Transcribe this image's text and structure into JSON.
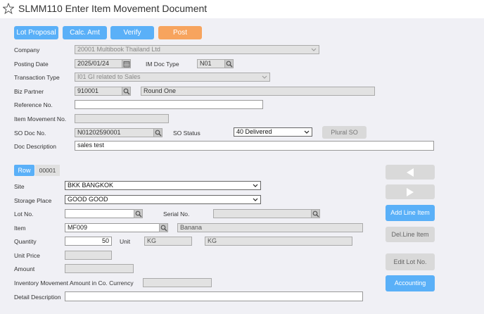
{
  "title": "SLMM110 Enter Item Movement Document",
  "toolbar": {
    "lot_proposal": "Lot Proposal",
    "calc_amt": "Calc. Amt",
    "verify": "Verify",
    "post": "Post"
  },
  "header": {
    "company_label": "Company",
    "company_value": "20001 Multibook Thailand Ltd",
    "posting_date_label": "Posting Date",
    "posting_date_value": "2025/01/24",
    "im_doc_type_label": "IM Doc Type",
    "im_doc_type_value": "N01",
    "transaction_type_label": "Transaction Type",
    "transaction_type_value": "I01 GI related to Sales",
    "biz_partner_label": "Biz Partner",
    "biz_partner_code": "910001",
    "biz_partner_name": "Round One",
    "reference_no_label": "Reference No.",
    "reference_no_value": "",
    "item_movement_no_label": "Item Movement No.",
    "item_movement_no_value": "",
    "so_doc_no_label": "SO Doc No.",
    "so_doc_no_value": "N01202590001",
    "so_status_label": "SO Status",
    "so_status_value": "40 Delivered",
    "plural_so": "Plural SO",
    "doc_description_label": "Doc Description",
    "doc_description_value": "sales test"
  },
  "line": {
    "row_label": "Row",
    "row_value": "00001",
    "site_label": "Site",
    "site_value": "BKK BANGKOK",
    "storage_place_label": "Storage Place",
    "storage_place_value": "GOOD GOOD",
    "lot_no_label": "Lot No.",
    "lot_no_value": "",
    "serial_no_label": "Serial No.",
    "serial_no_value": "",
    "item_label": "Item",
    "item_code": "MF009",
    "item_name": "Banana",
    "quantity_label": "Quantity",
    "quantity_value": "50",
    "unit_label": "Unit",
    "unit_code": "KG",
    "unit_name": "KG",
    "unit_price_label": "Unit Price",
    "unit_price_value": "",
    "amount_label": "Amount",
    "amount_value": "",
    "inv_amount_label": "Inventory Movement Amount in Co. Currency",
    "inv_amount_value": "",
    "detail_description_label": "Detail Description",
    "detail_description_value": ""
  },
  "side_buttons": {
    "add_line_item": "Add Line Item",
    "del_line_item": "Del.Line Item",
    "edit_lot_no": "Edit Lot No.",
    "accounting": "Accounting"
  },
  "colors": {
    "accent_blue": "#5ab0f8",
    "post_orange": "#f7a45e",
    "background": "#f0f0f5"
  },
  "icons": [
    "star-icon",
    "calendar-icon",
    "search-icon",
    "chevron-down-icon",
    "arrow-left-icon",
    "arrow-right-icon"
  ]
}
